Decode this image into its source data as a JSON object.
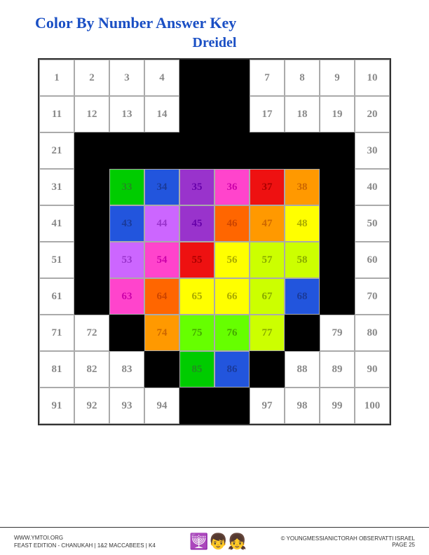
{
  "header": {
    "title": "Color By Number Answer Key",
    "subtitle": "Dreidel"
  },
  "footer": {
    "website": "WWW.YMTOI.ORG",
    "edition": "FEAST EDITION - CHANUKAH  |  1&2 MACCABEES  |  K4",
    "copyright": "© YOUNGMESSIANICTORAH OBSERVATTI ISRAEL",
    "page": "PAGE 25"
  },
  "grid": {
    "rows": 10,
    "cols": 10
  }
}
